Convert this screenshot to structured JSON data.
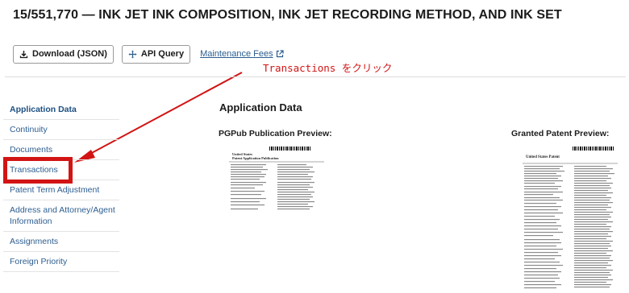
{
  "header": {
    "title": "15/551,770 — INK JET INK COMPOSITION, INK JET RECORDING METHOD, AND INK SET"
  },
  "toolbar": {
    "download_label": "Download (JSON)",
    "api_label": "API Query",
    "maintenance_label": "Maintenance Fees"
  },
  "annotation": {
    "text": "Transactions をクリック",
    "color": "#d21414"
  },
  "sidebar": {
    "items": [
      {
        "label": "Application Data"
      },
      {
        "label": "Continuity"
      },
      {
        "label": "Documents"
      },
      {
        "label": "Transactions"
      },
      {
        "label": "Patent Term Adjustment"
      },
      {
        "label": "Address and Attorney/Agent Information"
      },
      {
        "label": "Assignments"
      },
      {
        "label": "Foreign Priority"
      }
    ]
  },
  "main": {
    "title": "Application Data",
    "pgpub_label": "PGPub Publication Preview:",
    "granted_label": "Granted Patent Preview:",
    "pgpub_doc": {
      "heading_1": "United States",
      "heading_2": "Patent Application Publication"
    },
    "granted_doc": {
      "heading_1": "United States Patent"
    }
  },
  "colors": {
    "link": "#2a5d8f",
    "annotation": "#d21414",
    "sidebar_active": "#1d4f82"
  }
}
